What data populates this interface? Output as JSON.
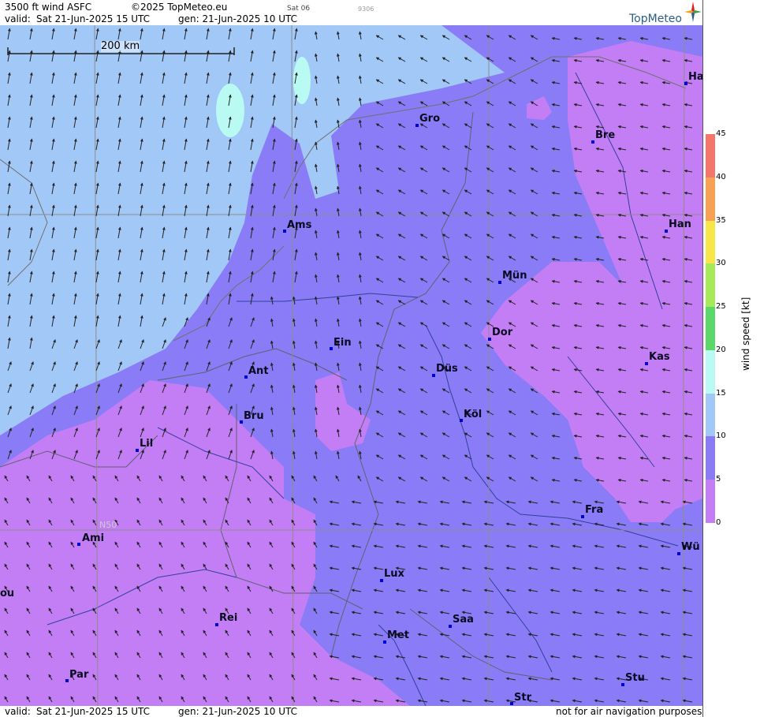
{
  "header": {
    "product": "3500 ft wind ASFC",
    "copyright": "©2025 TopMeteo.eu",
    "run_day": "Sat 06",
    "code": "9306",
    "valid_prefix": "valid:",
    "valid_time": "Sat  21-Jun-2025  15 UTC",
    "gen_time": "gen: 21-Jun-2025 10 UTC",
    "logo": "TopMeteo"
  },
  "map": {
    "scale_label": "200 km",
    "lat_label": "N50",
    "colors": {
      "sea_light": "#a2c8f7",
      "very_light": "#b9fbf3",
      "mid": "#8a7cf6",
      "weak": "#c47ef5",
      "grid": "#8c8c8c",
      "dot": "#0000d0"
    },
    "cities": [
      {
        "name": "Gro"
      },
      {
        "name": "Bre"
      },
      {
        "name": "Ha"
      },
      {
        "name": "Ams"
      },
      {
        "name": "Han"
      },
      {
        "name": "Mün"
      },
      {
        "name": "Ein"
      },
      {
        "name": "Dor"
      },
      {
        "name": "Düs"
      },
      {
        "name": "Kas"
      },
      {
        "name": "Ant"
      },
      {
        "name": "Bru"
      },
      {
        "name": "Köl"
      },
      {
        "name": "Lil"
      },
      {
        "name": "Fra"
      },
      {
        "name": "Ami"
      },
      {
        "name": "Wü"
      },
      {
        "name": "Lux"
      },
      {
        "name": "ou"
      },
      {
        "name": "Rei"
      },
      {
        "name": "Saa"
      },
      {
        "name": "Met"
      },
      {
        "name": "Par"
      },
      {
        "name": "Stu"
      },
      {
        "name": "Str"
      }
    ]
  },
  "footer": {
    "valid_prefix": "valid:",
    "valid_time": "Sat  21-Jun-2025  15 UTC",
    "gen_time": "gen: 21-Jun-2025 10 UTC",
    "disclaimer": "not for air navigation purposes"
  },
  "legend": {
    "title": "wind speed [kt]",
    "ticks": [
      "45",
      "40",
      "35",
      "30",
      "25",
      "20",
      "15",
      "10",
      "5",
      "0"
    ],
    "bands": [
      {
        "from": 40,
        "to": 45,
        "color": "#f4756a"
      },
      {
        "from": 35,
        "to": 40,
        "color": "#f8a152"
      },
      {
        "from": 30,
        "to": 35,
        "color": "#f8e547"
      },
      {
        "from": 25,
        "to": 30,
        "color": "#a6ea5a"
      },
      {
        "from": 20,
        "to": 25,
        "color": "#5ad86a"
      },
      {
        "from": 15,
        "to": 20,
        "color": "#b9fbf3"
      },
      {
        "from": 10,
        "to": 15,
        "color": "#a2c8f7"
      },
      {
        "from": 5,
        "to": 10,
        "color": "#8a7cf6"
      },
      {
        "from": 0,
        "to": 5,
        "color": "#c47ef5"
      }
    ]
  }
}
